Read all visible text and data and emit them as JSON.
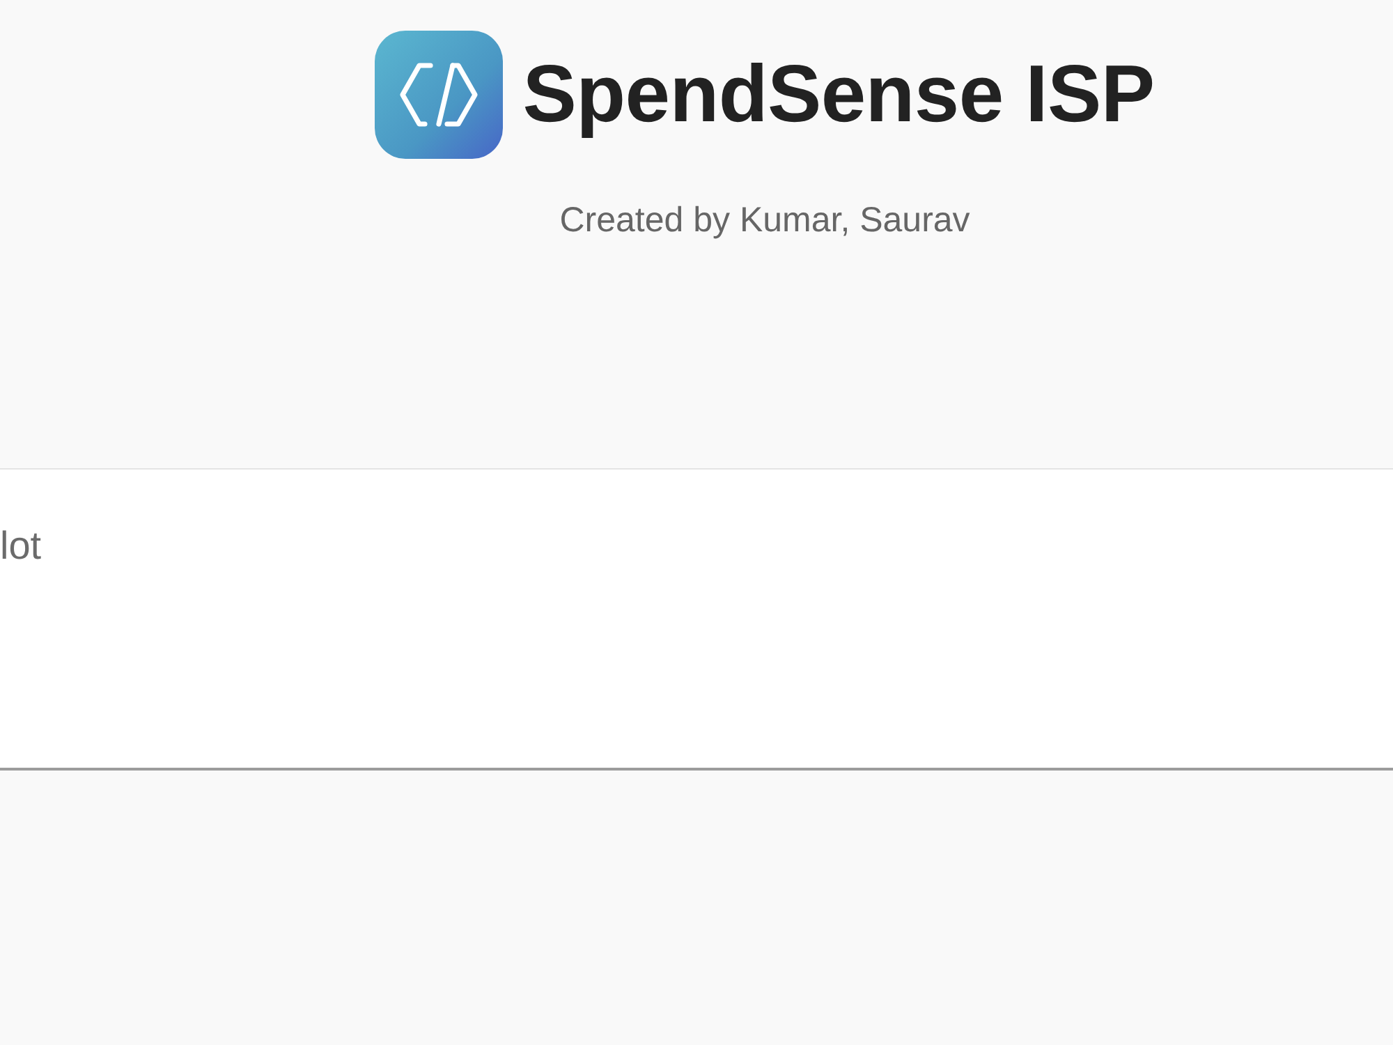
{
  "header": {
    "app_name": "SpendSense ISP",
    "subtitle": "Created by Kumar, Saurav"
  },
  "text_field": {
    "value": "lot"
  }
}
